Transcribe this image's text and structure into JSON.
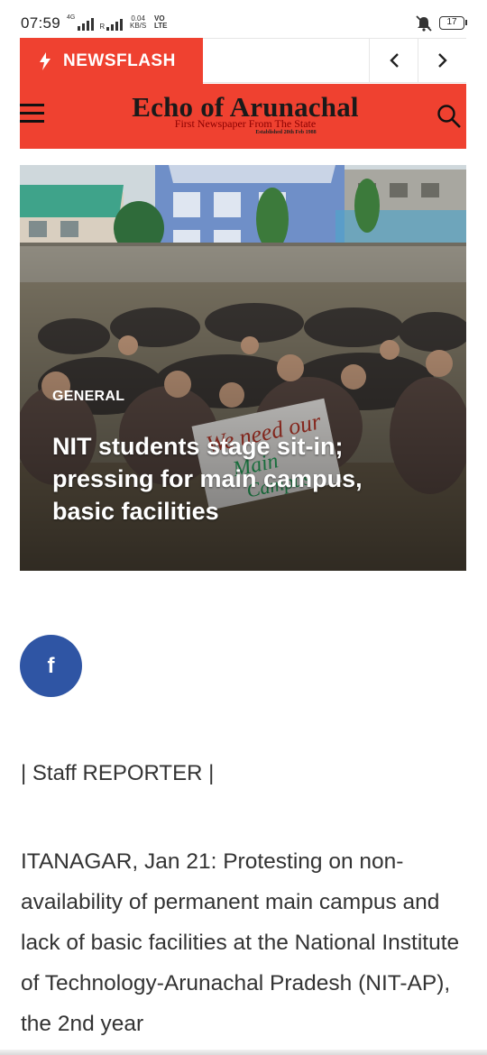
{
  "status_bar": {
    "time": "07:59",
    "network_tag": "4G",
    "speed_value": "0.04",
    "speed_unit": "KB/S",
    "volte_top": "VO",
    "volte_bottom": "LTE",
    "battery": "17"
  },
  "newsflash": {
    "label": "NEWSFLASH",
    "prev_icon": "chevron-left-icon",
    "next_icon": "chevron-right-icon"
  },
  "masthead": {
    "title": "Echo of Arunachal",
    "tagline": "First Newspaper From The State",
    "established": "Established 20th Feb 1988",
    "background": "#ef4130"
  },
  "hero": {
    "category": "GENERAL",
    "headline": "NIT students stage sit-in; pressing for main campus, basic facilities",
    "placard_text": "We need our Main Campus"
  },
  "share": {
    "facebook_label": "f",
    "facebook_color": "#2f55a4"
  },
  "article": {
    "byline": "| Staff REPORTER |",
    "body": "ITANAGAR, Jan 21: Protesting on non-availability of permanent main campus and lack of basic facilities at the National Institute of Technology-Arunachal Pradesh (NIT-AP), the 2nd year"
  }
}
